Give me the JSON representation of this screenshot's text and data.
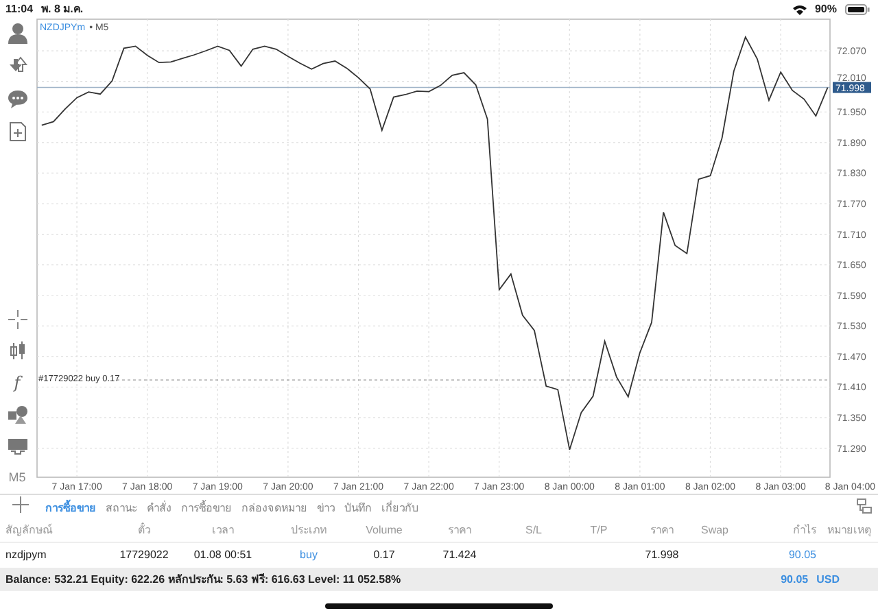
{
  "status_bar": {
    "time": "11:04",
    "date": "พ. 8 ม.ค.",
    "battery": "90%"
  },
  "toolbar": {
    "indicator": "f",
    "timeframe": "M5"
  },
  "chart": {
    "symbol": "NZDJPYm",
    "period": "• M5",
    "chart_data": {
      "type": "line",
      "grid": true,
      "ref_lines": [
        {
          "axis": "y",
          "value": 71.998,
          "label": "71.998"
        },
        {
          "axis": "y",
          "value": 71.424,
          "label": "#17729022 buy 0.17"
        }
      ],
      "categories": [
        null,
        null,
        null,
        "7 Jan 17:00",
        null,
        null,
        null,
        null,
        null,
        "7 Jan 18:00",
        null,
        null,
        null,
        null,
        null,
        "7 Jan 19:00",
        null,
        null,
        null,
        null,
        null,
        "7 Jan 20:00",
        null,
        null,
        null,
        null,
        null,
        "7 Jan 21:00",
        null,
        null,
        null,
        null,
        null,
        "7 Jan 22:00",
        null,
        null,
        null,
        null,
        null,
        "7 Jan 23:00",
        null,
        null,
        null,
        null,
        null,
        "8 Jan 00:00",
        null,
        null,
        null,
        null,
        null,
        "8 Jan 01:00",
        null,
        null,
        null,
        null,
        null,
        "8 Jan 02:00",
        null,
        null,
        null,
        null,
        null,
        "8 Jan 03:00",
        null,
        null,
        null,
        null,
        null,
        "8 Jan 04:00"
      ],
      "series": [
        {
          "color": "#333333",
          "values": [
            71.924,
            71.931,
            71.956,
            71.978,
            71.989,
            71.985,
            72.011,
            72.075,
            72.079,
            72.061,
            72.047,
            72.048,
            72.055,
            72.062,
            72.07,
            72.079,
            72.071,
            72.04,
            72.073,
            72.079,
            72.073,
            72.059,
            72.046,
            72.034,
            72.045,
            72.05,
            72.036,
            72.017,
            71.995,
            71.914,
            71.979,
            71.984,
            71.991,
            71.99,
            72.002,
            72.022,
            72.027,
            72.003,
            71.936,
            71.601,
            71.632,
            71.551,
            71.521,
            71.412,
            71.405,
            71.287,
            71.36,
            71.392,
            71.5,
            71.43,
            71.391,
            71.477,
            71.537,
            71.753,
            71.688,
            71.672,
            71.818,
            71.825,
            71.899,
            72.03,
            72.097,
            72.054,
            71.973,
            72.028,
            71.992,
            71.975,
            71.942,
            71.998,
            null,
            null
          ]
        }
      ],
      "ylim": [
        71.233,
        72.132
      ],
      "yticks": [
        {
          "value": 72.07,
          "label": "72.070"
        },
        {
          "value": 72.01,
          "label": "72.010"
        },
        {
          "value": 71.95,
          "label": "71.950"
        },
        {
          "value": 71.89,
          "label": "71.890"
        },
        {
          "value": 71.83,
          "label": "71.830"
        },
        {
          "value": 71.77,
          "label": "71.770"
        },
        {
          "value": 71.71,
          "label": "71.710"
        },
        {
          "value": 71.65,
          "label": "71.650"
        },
        {
          "value": 71.59,
          "label": "71.590"
        },
        {
          "value": 71.53,
          "label": "71.530"
        },
        {
          "value": 71.47,
          "label": "71.470"
        },
        {
          "value": 71.41,
          "label": "71.410"
        },
        {
          "value": 71.35,
          "label": "71.350"
        },
        {
          "value": 71.29,
          "label": "71.290"
        }
      ]
    }
  },
  "terminal": {
    "tabs": [
      {
        "label": "การซื้อขาย",
        "selected": true
      },
      {
        "label": "สถานะ",
        "selected": false
      },
      {
        "label": "คำสั่ง",
        "selected": false
      },
      {
        "label": "การซื้อขาย",
        "selected": false
      },
      {
        "label": "กล่องจดหมาย",
        "selected": false
      },
      {
        "label": "ข่าว",
        "selected": false
      },
      {
        "label": "บันทึก",
        "selected": false
      },
      {
        "label": "เกี่ยวกับ",
        "selected": false
      }
    ],
    "columns": [
      "สัญลักษณ์",
      "ตั๋ว",
      "เวลา",
      "ประเภท",
      "Volume",
      "ราคา",
      "S/L",
      "T/P",
      "ราคา",
      "Swap",
      "กำไร",
      "หมายเหตุ"
    ],
    "rows": [
      {
        "symbol": "nzdjpym",
        "ticket": "17729022",
        "time": "01.08 00:51",
        "type": "buy",
        "volume": "0.17",
        "open_price": "71.424",
        "current_price": "71.998",
        "profit": "90.05"
      }
    ],
    "summary": "Balance: 532.21 Equity: 622.26 หลักประกัน: 5.63 ฟรี: 616.63 Level: 11 052.58%",
    "total_profit": "90.05",
    "currency": "USD"
  }
}
